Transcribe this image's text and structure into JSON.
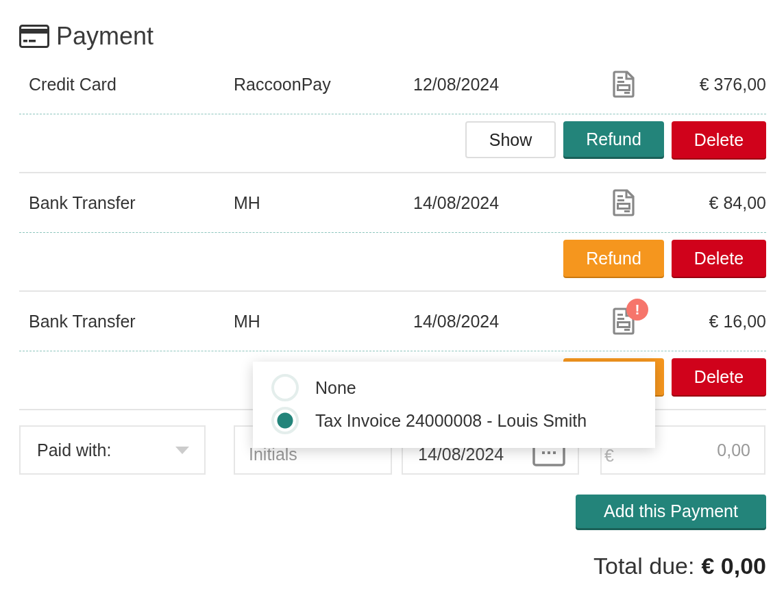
{
  "section": {
    "title": "Payment"
  },
  "payments": [
    {
      "method": "Credit Card",
      "by": "RaccoonPay",
      "date": "12/08/2024",
      "warning": false,
      "amount": "€ 376,00",
      "actions": [
        {
          "kind": "show",
          "label": "Show"
        },
        {
          "kind": "refund",
          "pending": false,
          "label": "Refund"
        },
        {
          "kind": "delete",
          "label": "Delete"
        }
      ]
    },
    {
      "method": "Bank Transfer",
      "by": "MH",
      "date": "14/08/2024",
      "warning": false,
      "amount": "€ 84,00",
      "actions": [
        {
          "kind": "refund",
          "pending": true,
          "label": "Refund"
        },
        {
          "kind": "delete",
          "label": "Delete"
        }
      ]
    },
    {
      "method": "Bank Transfer",
      "by": "MH",
      "date": "14/08/2024",
      "warning": true,
      "badge": "!",
      "amount": "€ 16,00",
      "actions": [
        {
          "kind": "refund",
          "pending": true
        },
        {
          "kind": "delete",
          "label": "Delete"
        }
      ]
    }
  ],
  "form": {
    "paid_with": {
      "value": "Paid with:"
    },
    "initials": {
      "placeholder": "Initials"
    },
    "date": {
      "value": "14/08/2024"
    },
    "amount": {
      "prefix": "€",
      "placeholder": "0,00"
    },
    "add_button": "Add this Payment"
  },
  "invoice_menu": [
    {
      "label": "None",
      "selected": false
    },
    {
      "label": "Tax Invoice 24000008 - Louis Smith",
      "selected": true
    }
  ],
  "total": {
    "label": "Total due:",
    "value": "€ 0,00"
  }
}
